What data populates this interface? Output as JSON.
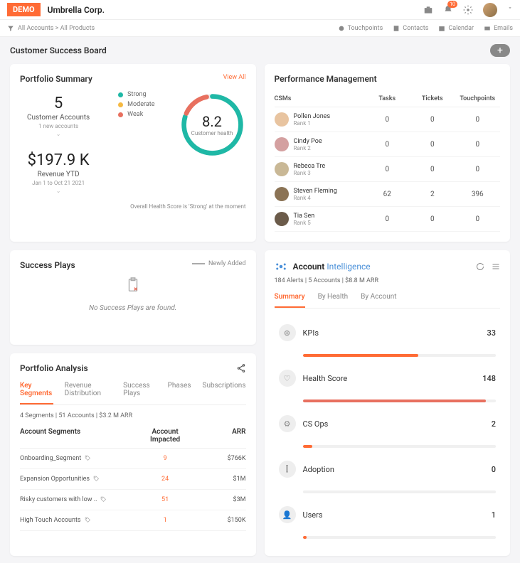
{
  "header": {
    "demo": "DEMO",
    "company": "Umbrella Corp.",
    "notif_count": "10",
    "nav": {
      "touchpoints": "Touchpoints",
      "contacts": "Contacts",
      "calendar": "Calendar",
      "emails": "Emails"
    }
  },
  "breadcrumb": "All Accounts > All Products",
  "page_title": "Customer Success Board",
  "portfolio": {
    "title": "Portfolio Summary",
    "view_all": "View All",
    "accounts_n": "5",
    "accounts_lbl": "Customer Accounts",
    "accounts_sub": "1 new accounts",
    "revenue": "$197.9 K",
    "revenue_lbl": "Revenue YTD",
    "revenue_sub": "Jan 1 to Oct 21 2021",
    "legend": {
      "strong": "Strong",
      "moderate": "Moderate",
      "weak": "Weak"
    },
    "legend_colors": {
      "strong": "#1fb8a6",
      "moderate": "#f5b942",
      "weak": "#e8705f"
    },
    "score": "8.2",
    "score_lbl": "Customer health",
    "msg": "Overall Health Score is 'Strong' at the moment"
  },
  "performance": {
    "title": "Performance Management",
    "cols": {
      "csms": "CSMs",
      "tasks": "Tasks",
      "tickets": "Tickets",
      "tp": "Touchpoints"
    },
    "rows": [
      {
        "name": "Pollen Jones",
        "rank": "Rank 1",
        "tasks": "0",
        "tickets": "0",
        "tp": "0",
        "color": "#e8c4a0"
      },
      {
        "name": "Cindy Poe",
        "rank": "Rank 2",
        "tasks": "0",
        "tickets": "0",
        "tp": "0",
        "color": "#d4a0a0"
      },
      {
        "name": "Rebeca Tre",
        "rank": "Rank 3",
        "tasks": "0",
        "tickets": "0",
        "tp": "0",
        "color": "#c9b896"
      },
      {
        "name": "Steven Fleming",
        "rank": "Rank 4",
        "tasks": "62",
        "tickets": "2",
        "tp": "396",
        "color": "#8b7355"
      },
      {
        "name": "Tia Sen",
        "rank": "Rank 5",
        "tasks": "0",
        "tickets": "0",
        "tp": "0",
        "color": "#6b5b4a"
      }
    ]
  },
  "success_plays": {
    "title": "Success Plays",
    "badge": "Newly Added",
    "empty": "No Success Plays are found."
  },
  "analysis": {
    "title": "Portfolio Analysis",
    "tabs": [
      "Key Segments",
      "Revenue Distribution",
      "Success Plays",
      "Phases",
      "Subscriptions"
    ],
    "summary": "4 Segments  |  51 Accounts  |  $3.2 M  ARR",
    "cols": {
      "seg": "Account Segments",
      "impact": "Account Impacted",
      "arr": "ARR"
    },
    "rows": [
      {
        "seg": "Onboarding_Segment",
        "impact": "9",
        "arr": "$766K"
      },
      {
        "seg": "Expansion Opportunities",
        "impact": "24",
        "arr": "$1M"
      },
      {
        "seg": "Risky customers with low ..",
        "impact": "51",
        "arr": "$3M"
      },
      {
        "seg": "High Touch Accounts",
        "impact": "1",
        "arr": "$150K"
      }
    ]
  },
  "ai": {
    "brand_a": "Account ",
    "brand_b": "Intelligence",
    "summary": "184 Alerts |  5 Accounts  | $8.8 M ARR",
    "tabs": [
      "Summary",
      "By Health",
      "By Account"
    ],
    "blocks": [
      {
        "name": "KPIs",
        "val": "33",
        "fill": 60,
        "color": "#ff6b35"
      },
      {
        "name": "Health Score",
        "val": "148",
        "fill": 95,
        "color": "#e8705f"
      },
      {
        "name": "CS Ops",
        "val": "2",
        "fill": 5,
        "color": "#ff6b35"
      },
      {
        "name": "Adoption",
        "val": "0",
        "fill": 0,
        "color": "#ff6b35"
      },
      {
        "name": "Users",
        "val": "1",
        "fill": 2,
        "color": "#ff6b35"
      }
    ]
  }
}
